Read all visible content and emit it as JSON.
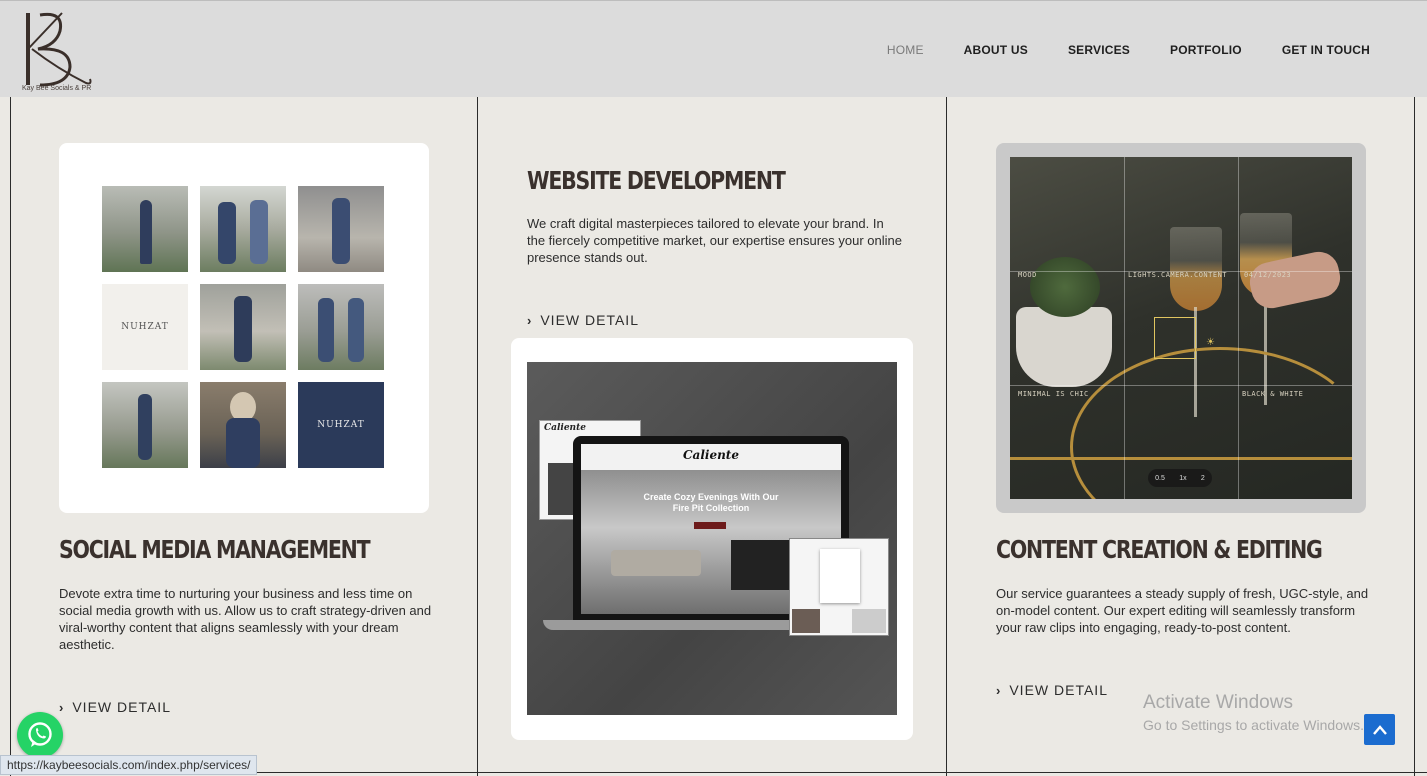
{
  "header": {
    "logo_tagline": "Kay Bee Socials & PR",
    "nav": [
      {
        "label": "HOME",
        "active": true
      },
      {
        "label": "ABOUT US"
      },
      {
        "label": "SERVICES"
      },
      {
        "label": "PORTFOLIO"
      },
      {
        "label": "GET IN TOUCH"
      }
    ]
  },
  "services": [
    {
      "title": "SOCIAL MEDIA MANAGEMENT",
      "description": "Devote extra time to nurturing your business and less time on social media growth with us. Allow us to craft strategy-driven and viral-worthy content that aligns seamlessly with your dream aesthetic.",
      "link": "VIEW DETAIL",
      "grid_brand": "NUHZAT"
    },
    {
      "title": "WEBSITE DEVELOPMENT",
      "description": "We craft digital masterpieces tailored to elevate your brand. In the fiercely competitive market, our expertise ensures your online presence stands out.",
      "link": "VIEW DETAIL",
      "mockup": {
        "brand": "Caliente",
        "hero": "Create Cozy Evenings With Our Fire Pit Collection"
      }
    },
    {
      "title": "CONTENT CREATION & EDITING",
      "description": "Our service guarantees a steady supply of fresh, UGC-style, and on-model content. Our expert editing will seamlessly transform your raw clips into engaging, ready-to-post content.",
      "link": "VIEW DETAIL",
      "photo_overlay": {
        "top_left": "MOOD",
        "top_mid": "LIGHTS.CAMERA.CONTENT",
        "top_right": "04/12/2023",
        "bottom_left": "MINIMAL IS CHIC",
        "bottom_right": "BLACK & WHITE",
        "zoom": [
          "0.5",
          "1x",
          "2"
        ]
      }
    }
  ],
  "windows_activation": {
    "title": "Activate Windows",
    "subtitle": "Go to Settings to activate Windows."
  },
  "status_url": "https://kaybeesocials.com/index.php/services/",
  "colors": {
    "header_bg": "#dcdcdc",
    "page_bg": "#ebe9e4",
    "title": "#3a312d",
    "whatsapp": "#25d366",
    "scroll_top": "#1b6ccf"
  }
}
